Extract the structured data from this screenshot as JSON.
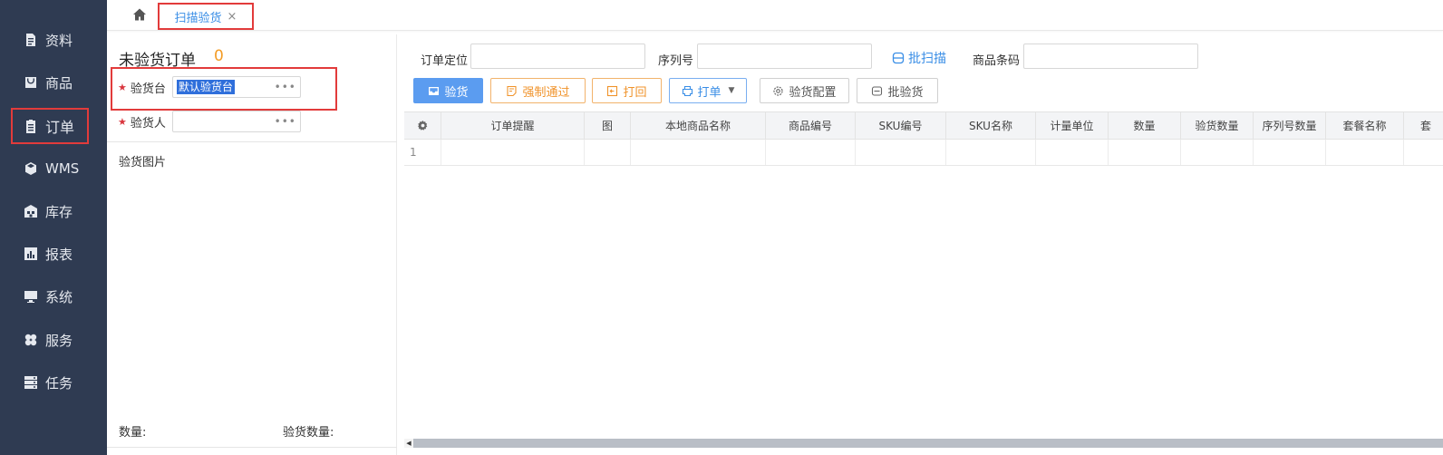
{
  "sidebar": {
    "items": [
      {
        "label": "资料",
        "icon": "document-icon"
      },
      {
        "label": "商品",
        "icon": "bag-icon"
      },
      {
        "label": "订单",
        "icon": "clipboard-icon",
        "active": true
      },
      {
        "label": "WMS",
        "icon": "cube-icon"
      },
      {
        "label": "库存",
        "icon": "warehouse-icon"
      },
      {
        "label": "报表",
        "icon": "bar-chart-icon"
      },
      {
        "label": "系统",
        "icon": "monitor-icon"
      },
      {
        "label": "服务",
        "icon": "clover-icon"
      },
      {
        "label": "任务",
        "icon": "server-icon"
      }
    ]
  },
  "tabbar": {
    "home_icon": "home-icon",
    "tab_label": "扫描验货",
    "tab_close": "×"
  },
  "left_panel": {
    "title": "未验货订单",
    "count": "0",
    "station_label": "验货台",
    "station_value": "默认验货台",
    "inspector_label": "验货人",
    "inspector_value": "",
    "lookup_dots": "•••",
    "images_title": "验货图片",
    "footer_qty_label": "数量:",
    "footer_checked_label": "验货数量:"
  },
  "search": {
    "order_label": "订单定位",
    "serial_label": "序列号",
    "batch_scan": "批扫描",
    "barcode_label": "商品条码"
  },
  "toolbar": {
    "inspect": "验货",
    "force_pass": "强制通过",
    "return": "打回",
    "print": "打单",
    "config": "验货配置",
    "batch_inspect": "批验货"
  },
  "grid": {
    "columns": [
      "订单提醒",
      "图",
      "本地商品名称",
      "商品编号",
      "SKU编号",
      "SKU名称",
      "计量单位",
      "数量",
      "验货数量",
      "序列号数量",
      "套餐名称",
      "套"
    ],
    "rows": [
      {
        "num": "1"
      }
    ]
  },
  "colors": {
    "sidebar_bg": "#2f3b52",
    "accent_blue": "#3a8ee6",
    "primary_btn": "#5b9cf0",
    "warn_orange": "#f0932b",
    "highlight_red": "#e23b3b"
  }
}
